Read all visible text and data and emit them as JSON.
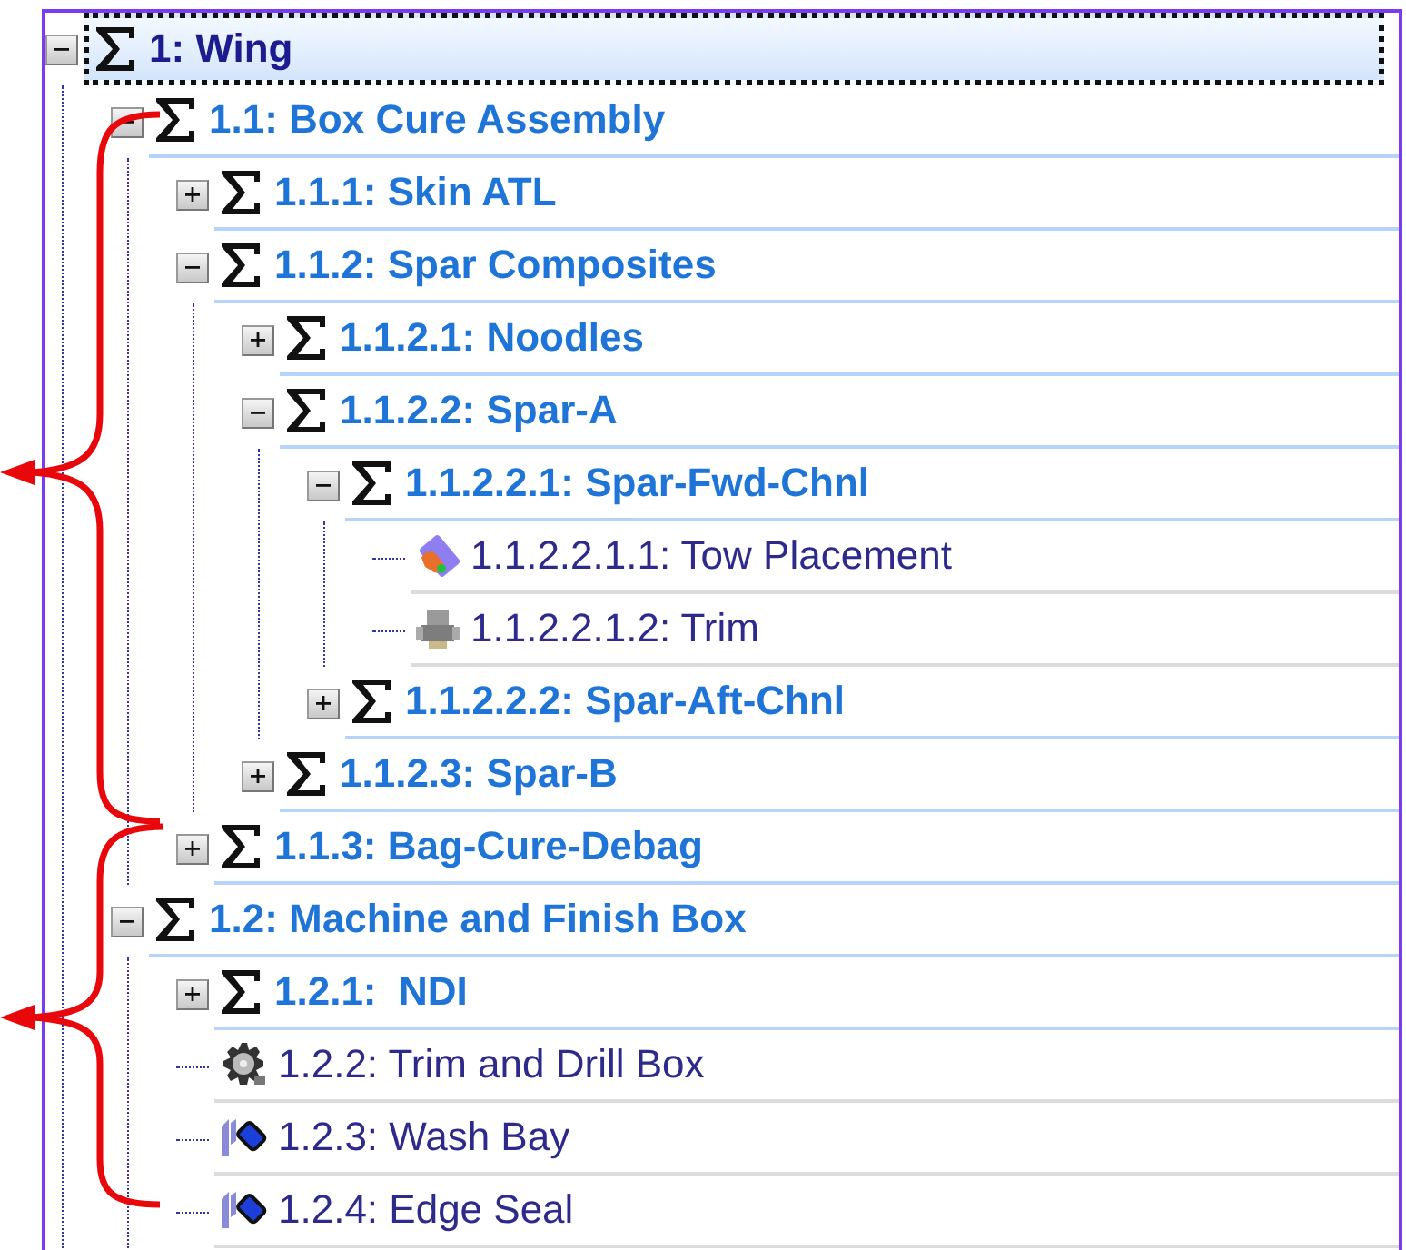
{
  "tree": [
    {
      "label": "1: Wing",
      "kind": "group",
      "expanded": true,
      "selected": true,
      "children": [
        {
          "label": "1.1: Box Cure Assembly",
          "kind": "group",
          "expanded": true,
          "selected": false,
          "children": [
            {
              "label": "1.1.1: Skin ATL",
              "kind": "group",
              "expanded": false,
              "selected": false
            },
            {
              "label": "1.1.2: Spar Composites",
              "kind": "group",
              "expanded": true,
              "selected": false,
              "children": [
                {
                  "label": "1.1.2.1: Noodles",
                  "kind": "group",
                  "expanded": false,
                  "selected": false
                },
                {
                  "label": "1.1.2.2: Spar-A",
                  "kind": "group",
                  "expanded": true,
                  "selected": false,
                  "children": [
                    {
                      "label": "1.1.2.2.1: Spar-Fwd-Chnl",
                      "kind": "group",
                      "expanded": true,
                      "selected": false,
                      "children": [
                        {
                          "label": "1.1.2.2.1.1: Tow Placement",
                          "kind": "tow",
                          "selected": false
                        },
                        {
                          "label": "1.1.2.2.1.2: Trim",
                          "kind": "machine",
                          "selected": false
                        }
                      ]
                    },
                    {
                      "label": "1.1.2.2.2: Spar-Aft-Chnl",
                      "kind": "group",
                      "expanded": false,
                      "selected": false
                    }
                  ]
                },
                {
                  "label": "1.1.2.3: Spar-B",
                  "kind": "group",
                  "expanded": false,
                  "selected": false
                }
              ]
            },
            {
              "label": "1.1.3: Bag-Cure-Debag",
              "kind": "group",
              "expanded": false,
              "selected": false
            }
          ]
        },
        {
          "label": "1.2: Machine and Finish Box",
          "kind": "group",
          "expanded": true,
          "selected": false,
          "children": [
            {
              "label": "1.2.1:  NDI",
              "kind": "group",
              "expanded": false,
              "selected": false
            },
            {
              "label": "1.2.2: Trim and Drill Box",
              "kind": "gear",
              "selected": false
            },
            {
              "label": "1.2.3: Wash Bay",
              "kind": "wash",
              "selected": false
            },
            {
              "label": "1.2.4: Edge Seal",
              "kind": "wash",
              "selected": false
            }
          ]
        }
      ]
    }
  ]
}
